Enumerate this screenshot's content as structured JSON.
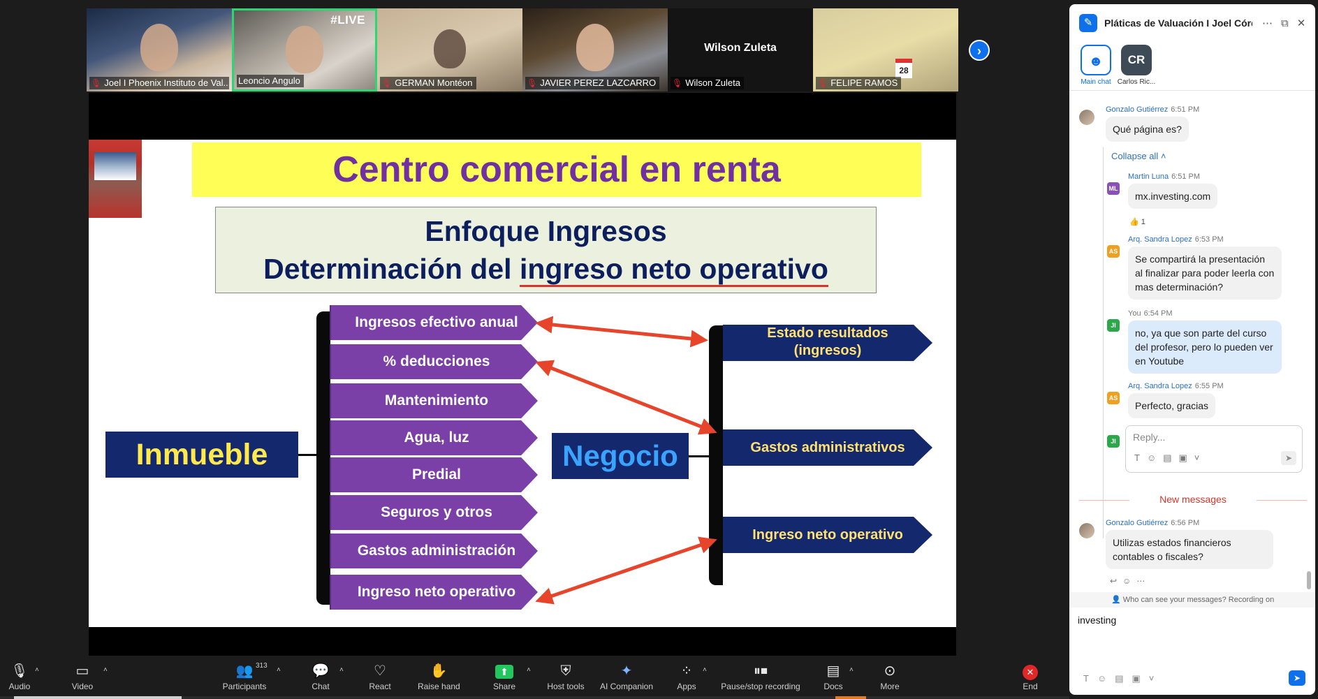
{
  "participants_strip": {
    "tiles": [
      {
        "name": "Joel I Phoenix Instituto de Val...",
        "muted": true
      },
      {
        "name": "Leoncio Angulo",
        "muted": false,
        "active_speaker": true,
        "overlay": "#LIVE"
      },
      {
        "name": "GERMAN Montéon",
        "muted": true
      },
      {
        "name": "JAVIER PEREZ LAZCARRO",
        "muted": true
      },
      {
        "name": "Wilson Zuleta",
        "muted": true,
        "video_off_label": "Wilson Zuleta"
      },
      {
        "name": "FELIPE RAMOS",
        "muted": true,
        "calendar_number": "28"
      }
    ],
    "next_page_icon": "chevron-right-icon"
  },
  "slide": {
    "title": "Centro comercial en renta",
    "subtitle_line1": "Enfoque Ingresos",
    "subtitle_line2_prefix": "Determinación del ",
    "subtitle_line2_underlined": "ingreso neto operativo",
    "left_block": "Inmueble",
    "middle_block": "Negocio",
    "items": [
      "Ingresos efectivo anual",
      "% deducciones",
      "Mantenimiento",
      "Agua, luz",
      "Predial",
      "Seguros y otros",
      "Gastos administración",
      "Ingreso neto operativo"
    ],
    "right_items": [
      {
        "line1": "Estado resultados",
        "line2": "(ingresos)"
      },
      {
        "line1": "Gastos administrativos",
        "line2": ""
      },
      {
        "line1": "Ingreso neto operativo",
        "line2": ""
      }
    ],
    "colors": {
      "title_bg": "#fffe57",
      "title_text": "#7030a0",
      "navy": "#13286d",
      "purple": "#7b3fa8",
      "arrow": "#e6452b"
    }
  },
  "chat": {
    "title": "Pláticas de Valuación I Joel Córd...",
    "tabs": [
      {
        "label": "Main chat",
        "icon": "group-icon"
      },
      {
        "label": "Carlos Ric...",
        "initials": "CR"
      }
    ],
    "messages": [
      {
        "sender": "Gonzalo Gutiérrez",
        "time": "6:51 PM",
        "text": "Qué página es?"
      },
      {
        "sender": "Martin Luna",
        "time": "6:51 PM",
        "initials": "ML",
        "text": "mx.investing.com",
        "reaction": "👍 1"
      },
      {
        "sender": "Arq. Sandra Lopez",
        "time": "6:53 PM",
        "initials": "AS",
        "text": "Se compartirá la presentación al finalizar para poder leerla con mas determinación?"
      },
      {
        "sender": "You",
        "time": "6:54 PM",
        "initials": "JI",
        "text": " no, ya que son parte del curso del profesor, pero lo pueden ver en Youtube"
      },
      {
        "sender": "Arq. Sandra Lopez",
        "time": "6:55 PM",
        "initials": "AS",
        "text": "Perfecto, gracias"
      },
      {
        "sender": "Gonzalo Gutiérrez",
        "time": "6:56 PM",
        "text": "Utilizas estados financieros contables o fiscales?"
      }
    ],
    "collapse_label": "Collapse all ˄",
    "reply_placeholder": "Reply...",
    "reply_initials": "JI",
    "new_messages_label": "New messages",
    "privacy_text": "Who can see your messages? Recording on",
    "input_value": "investing"
  },
  "toolbar": {
    "items": [
      {
        "label": "Audio",
        "icon": "microphone-muted-icon"
      },
      {
        "label": "Video",
        "icon": "camera-icon"
      },
      {
        "label": "Participants",
        "icon": "participants-icon",
        "count": "313"
      },
      {
        "label": "Chat",
        "icon": "chat-icon"
      },
      {
        "label": "React",
        "icon": "heart-icon"
      },
      {
        "label": "Raise hand",
        "icon": "hand-icon"
      },
      {
        "label": "Share",
        "icon": "share-screen-icon"
      },
      {
        "label": "Host tools",
        "icon": "shield-icon"
      },
      {
        "label": "AI Companion",
        "icon": "sparkle-icon"
      },
      {
        "label": "Apps",
        "icon": "apps-icon"
      },
      {
        "label": "Pause/stop recording",
        "icon": "record-pause-icon"
      },
      {
        "label": "Docs",
        "icon": "docs-icon"
      },
      {
        "label": "More",
        "icon": "more-icon"
      },
      {
        "label": "End",
        "icon": "end-icon"
      }
    ]
  }
}
